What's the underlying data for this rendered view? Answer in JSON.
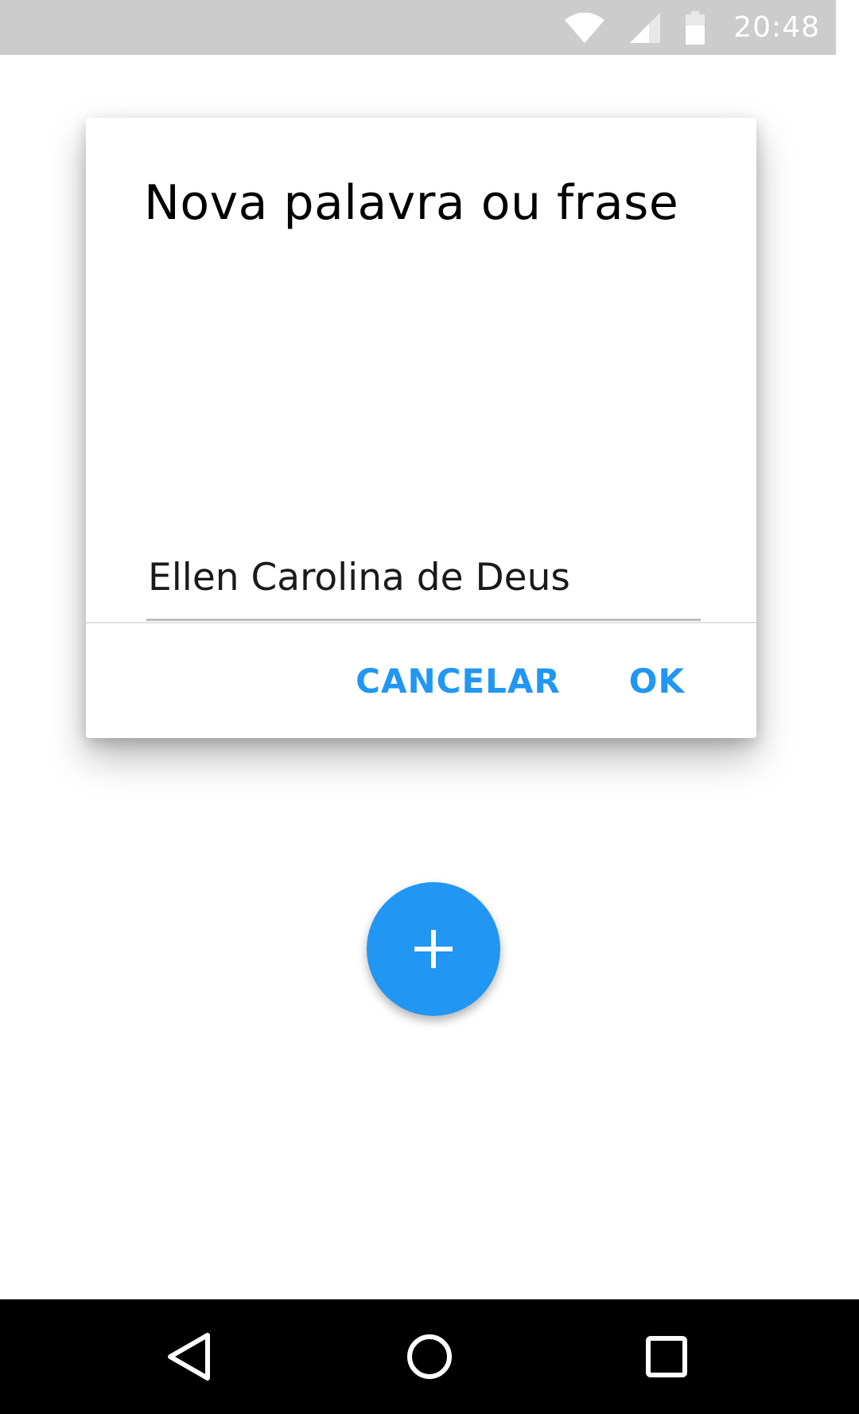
{
  "status_bar": {
    "time": "20:48",
    "icons": [
      "wifi-icon",
      "cell-signal-icon",
      "battery-icon"
    ],
    "background": "#cccccc"
  },
  "dialog": {
    "title": "Nova palavra ou frase",
    "input": {
      "value": "Ellen Carolina de Deus"
    },
    "buttons": {
      "cancel": "CANCELAR",
      "ok": "OK"
    },
    "accent_color": "#2196f3"
  },
  "fab": {
    "icon": "plus-icon",
    "color": "#2196f3"
  },
  "nav_bar": {
    "icons": [
      "back-icon",
      "home-icon",
      "recents-icon"
    ]
  }
}
